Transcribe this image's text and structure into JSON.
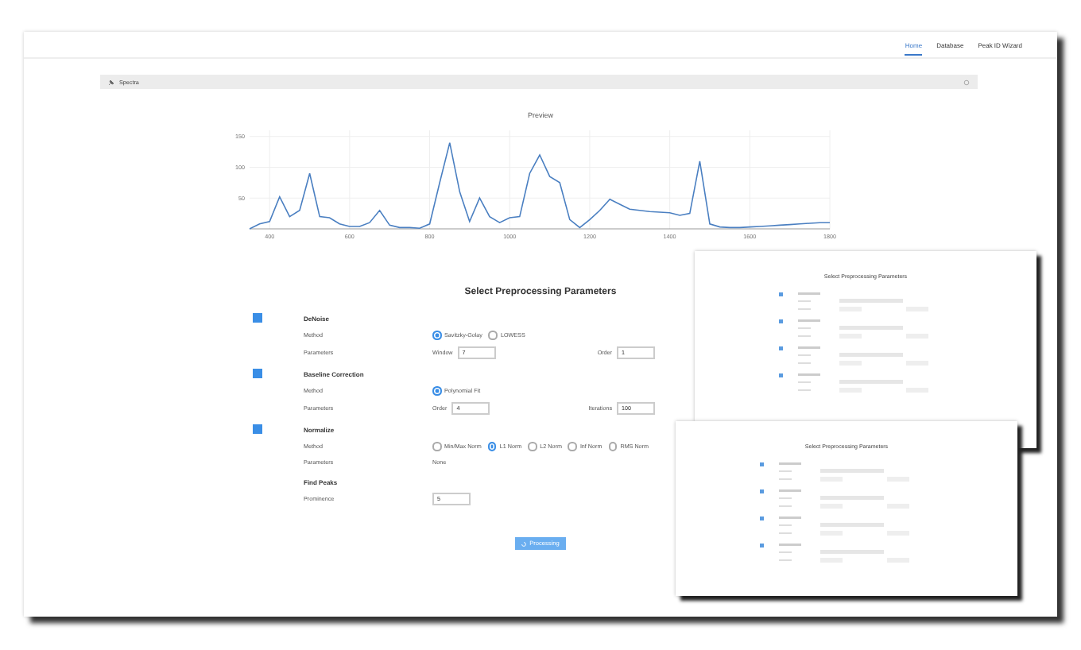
{
  "nav": [
    {
      "label": "Home",
      "selected": true
    },
    {
      "label": "Database",
      "selected": false
    },
    {
      "label": "Peak ID Wizard",
      "selected": false
    }
  ],
  "upload": {
    "label": "Spectra"
  },
  "preview": {
    "title": "Preview",
    "chart_data": {
      "type": "line",
      "xlim": [
        350,
        1800
      ],
      "ylim": [
        0,
        160
      ],
      "xticks": [
        400,
        600,
        800,
        1000,
        1200,
        1400,
        1600,
        1800
      ],
      "yticks": [
        50,
        100,
        150
      ],
      "x": [
        350,
        375,
        400,
        425,
        450,
        475,
        500,
        525,
        550,
        575,
        600,
        625,
        650,
        675,
        700,
        725,
        750,
        775,
        800,
        825,
        850,
        875,
        900,
        925,
        950,
        975,
        1000,
        1025,
        1050,
        1075,
        1100,
        1125,
        1150,
        1175,
        1200,
        1225,
        1250,
        1275,
        1300,
        1325,
        1350,
        1375,
        1400,
        1425,
        1450,
        1475,
        1500,
        1525,
        1550,
        1575,
        1600,
        1625,
        1650,
        1675,
        1700,
        1725,
        1750,
        1775,
        1800
      ],
      "grid": true,
      "series": [
        {
          "color": "#4a7fc1",
          "values": [
            0,
            8,
            12,
            52,
            20,
            30,
            90,
            20,
            18,
            8,
            4,
            4,
            10,
            30,
            6,
            2,
            2,
            1,
            8,
            75,
            140,
            60,
            12,
            50,
            20,
            10,
            18,
            20,
            90,
            120,
            85,
            75,
            15,
            2,
            15,
            30,
            48,
            40,
            32,
            30,
            28,
            27,
            26,
            22,
            25,
            110,
            8,
            3,
            2,
            2,
            3,
            4,
            5,
            6,
            7,
            8,
            9,
            10,
            10
          ]
        }
      ]
    }
  },
  "heading": "Select Preprocessing Parameters",
  "sections": [
    {
      "kind": "toggle",
      "checked": true,
      "title": "DeNoise",
      "rows": [
        {
          "kind": "radios",
          "label": "Method",
          "options": [
            {
              "label": "Savitzky-Golay",
              "selected": true
            },
            {
              "label": "LOWESS",
              "selected": false
            }
          ]
        },
        {
          "kind": "fields",
          "label": "Parameters",
          "fields": [
            {
              "label": "Window",
              "value": "7"
            },
            {
              "label": "Order",
              "value": "1"
            }
          ]
        }
      ]
    },
    {
      "kind": "toggle",
      "checked": true,
      "title": "Baseline Correction",
      "rows": [
        {
          "kind": "radios",
          "label": "Method",
          "options": [
            {
              "label": "Polynomial Fit",
              "selected": true
            }
          ]
        },
        {
          "kind": "fields",
          "label": "Parameters",
          "fields": [
            {
              "label": "Order",
              "value": "4"
            },
            {
              "label": "Iterations",
              "value": "100"
            }
          ]
        }
      ]
    },
    {
      "kind": "toggle",
      "checked": true,
      "title": "Normalize",
      "rows": [
        {
          "kind": "radios",
          "label": "Method",
          "options": [
            {
              "label": "Min/Max Norm",
              "selected": false
            },
            {
              "label": "L1 Norm",
              "selected": true
            },
            {
              "label": "L2 Norm",
              "selected": false
            },
            {
              "label": "Inf Norm",
              "selected": false
            },
            {
              "label": "RMS Norm",
              "selected": false
            }
          ]
        },
        {
          "kind": "text",
          "label": "Parameters",
          "text": "None"
        }
      ]
    },
    {
      "kind": "plain",
      "title": "Find Peaks",
      "rows": [
        {
          "kind": "fields",
          "label": "Prominence",
          "fields": [
            {
              "value": "5"
            }
          ]
        }
      ]
    }
  ],
  "submit": {
    "label": "Processing"
  },
  "thumbnails": [
    {
      "heading": "Select Preprocessing Parameters"
    },
    {
      "heading": "Select Preprocessing Parameters"
    }
  ]
}
